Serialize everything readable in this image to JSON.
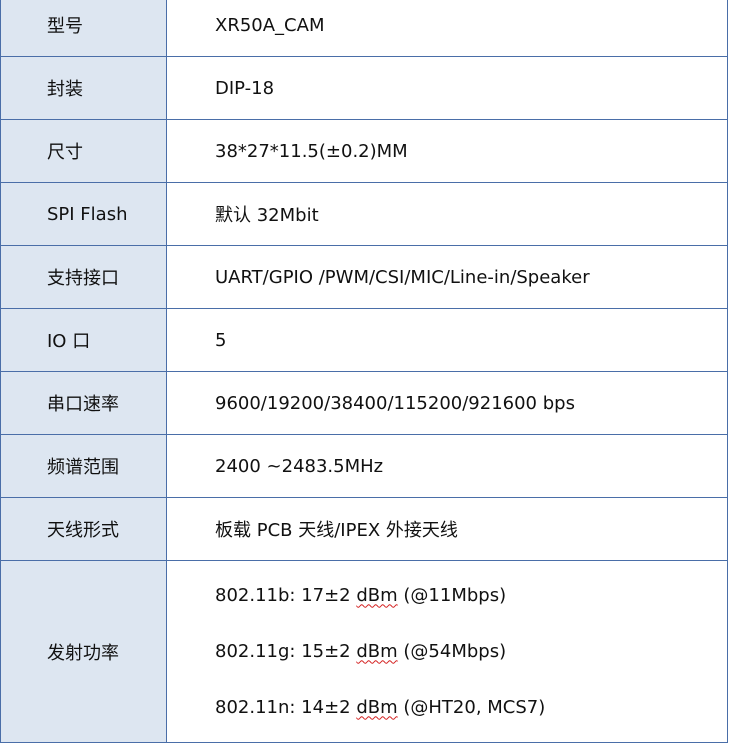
{
  "rows": [
    {
      "label": "型号",
      "value": "XR50A_CAM"
    },
    {
      "label": "封装",
      "value": "DIP-18"
    },
    {
      "label": "尺寸",
      "value": "38*27*11.5(±0.2)MM"
    },
    {
      "label": "SPI Flash",
      "value": "默认 32Mbit"
    },
    {
      "label": "支持接口",
      "value": "UART/GPIO /PWM/CSI/MIC/Line-in/Speaker"
    },
    {
      "label": "IO 口",
      "value": "5"
    },
    {
      "label": "串口速率",
      "value": "9600/19200/38400/115200/921600 bps"
    },
    {
      "label": "频谱范围",
      "value": "2400 ~2483.5MHz"
    },
    {
      "label": "天线形式",
      "value": "板载 PCB 天线/IPEX 外接天线"
    }
  ],
  "power": {
    "label": "发射功率",
    "lines": [
      {
        "pre": "802.11b: 17±2 ",
        "unit": "dBm",
        "post": " (@11Mbps)"
      },
      {
        "pre": "802.11g: 15±2 ",
        "unit": "dBm",
        "post": " (@54Mbps)"
      },
      {
        "pre": "802.11n: 14±2 ",
        "unit": "dBm",
        "post": " (@HT20, MCS7)"
      }
    ]
  },
  "colors": {
    "label_bg": "#dde6f1",
    "border": "#4a6ea8",
    "spell_underline": "#d42020"
  }
}
